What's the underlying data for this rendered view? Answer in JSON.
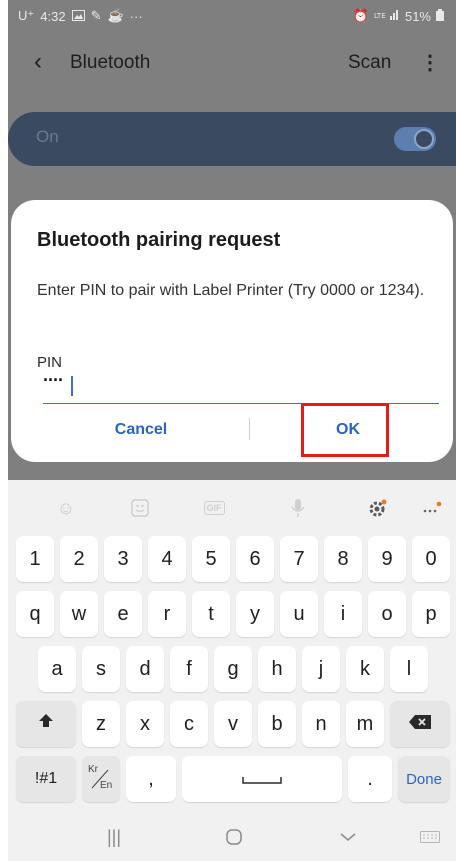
{
  "status_bar": {
    "time": "4:32",
    "carrier_icon": "U⁺",
    "extra_icons": "···",
    "battery_percent": "51%"
  },
  "app_bar": {
    "title": "Bluetooth",
    "scan_label": "Scan"
  },
  "bluetooth_toggle": {
    "label": "On",
    "state": "on"
  },
  "dialog": {
    "title": "Bluetooth pairing request",
    "message": "Enter PIN to pair with Label Printer (Try 0000 or 1234).",
    "pin_label": "PIN",
    "pin_value": "····",
    "cancel_label": "Cancel",
    "ok_label": "OK"
  },
  "keyboard": {
    "number_row": [
      "1",
      "2",
      "3",
      "4",
      "5",
      "6",
      "7",
      "8",
      "9",
      "0"
    ],
    "row1": [
      "q",
      "w",
      "e",
      "r",
      "t",
      "y",
      "u",
      "i",
      "o",
      "p"
    ],
    "row2": [
      "a",
      "s",
      "d",
      "f",
      "g",
      "h",
      "j",
      "k",
      "l"
    ],
    "row3": [
      "z",
      "x",
      "c",
      "v",
      "b",
      "n",
      "m"
    ],
    "symbols_label": "!#1",
    "lang_top": "Kr",
    "lang_bottom": "En",
    "comma_label": ",",
    "period_label": ".",
    "done_label": "Done"
  },
  "colors": {
    "accent_blue": "#2b63c4",
    "highlight_red": "#e81a1a",
    "scrim_gray": "#7f7f7f"
  }
}
